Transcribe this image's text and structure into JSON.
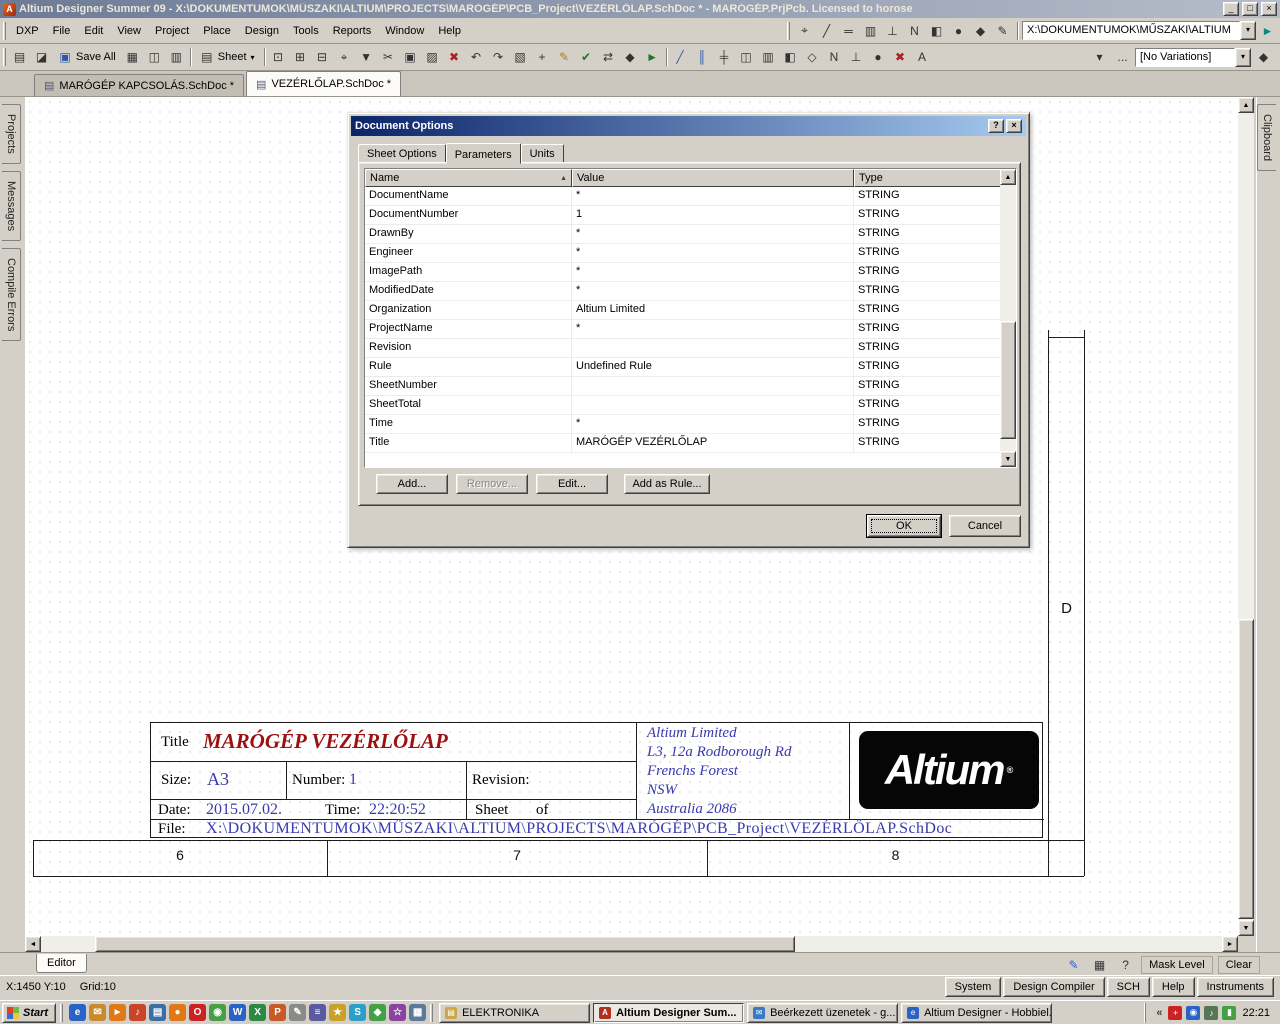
{
  "colors": {
    "window_face": "#d4d0c8",
    "dialog_title_left": "#0a246a",
    "dialog_title_right": "#a6caf0",
    "sheet_blue": "#3939b0",
    "sheet_title_red": "#9b1111"
  },
  "icons": {
    "minimize": "_",
    "maximize": "□",
    "close": "×",
    "help": "?",
    "dropdown": "▾",
    "sort_asc": "▲",
    "overflow": "...",
    "up": "▲",
    "down": "▼",
    "left": "◄",
    "right": "►",
    "chevron_left": "«"
  },
  "titlebar": {
    "title": "Altium Designer Summer 09 - X:\\DOKUMENTUMOK\\MŰSZAKI\\ALTIUM\\PROJECTS\\MARÓGÉP\\PCB_Project\\VEZÉRLŐLAP.SchDoc * - MARÓGÉP.PrjPcb. Licensed to horose"
  },
  "menubar": {
    "items": [
      "DXP",
      "File",
      "Edit",
      "View",
      "Project",
      "Place",
      "Design",
      "Tools",
      "Reports",
      "Window",
      "Help"
    ],
    "tool_icons": [
      {
        "name": "cross-select-icon",
        "glyph": "⌖"
      },
      {
        "name": "wire-icon",
        "glyph": "╱"
      },
      {
        "name": "bus-icon",
        "glyph": "═"
      },
      {
        "name": "part-icon",
        "glyph": "▥"
      },
      {
        "name": "power-port-icon",
        "glyph": "⊥"
      },
      {
        "name": "net-label-icon",
        "glyph": "N"
      },
      {
        "name": "port-icon",
        "glyph": "◧"
      },
      {
        "name": "junction-icon",
        "glyph": "●"
      },
      {
        "name": "directive-icon",
        "glyph": "◆"
      },
      {
        "name": "annotate-icon",
        "glyph": "✎"
      }
    ],
    "address_value": "X:\\DOKUMENTUMOK\\MŰSZAKI\\ALTIUM"
  },
  "toolbar": {
    "icons_a": [
      {
        "name": "new-document-icon",
        "glyph": "▤"
      },
      {
        "name": "open-icon",
        "glyph": "◪"
      }
    ],
    "save_all_label": "Save All",
    "icons_b": [
      {
        "name": "print-icon",
        "glyph": "▦"
      },
      {
        "name": "print-preview-icon",
        "glyph": "◫"
      },
      {
        "name": "device-view-icon",
        "glyph": "▥"
      }
    ],
    "sheet_label": "Sheet",
    "icons_c": [
      {
        "name": "zoom-fit-icon",
        "glyph": "⊡"
      },
      {
        "name": "zoom-area-icon",
        "glyph": "⊞"
      },
      {
        "name": "zoom-selected-icon",
        "glyph": "⊟"
      },
      {
        "name": "cross-probe-icon",
        "glyph": "⌖"
      },
      {
        "name": "filter-icon",
        "glyph": "▼"
      },
      {
        "name": "cut-icon",
        "glyph": "✂"
      },
      {
        "name": "copy-icon",
        "glyph": "▣"
      },
      {
        "name": "paste-icon",
        "glyph": "▨"
      },
      {
        "name": "clear-filter-icon",
        "glyph": "✖",
        "color": "#aa2222"
      },
      {
        "name": "undo-icon",
        "glyph": "↶"
      },
      {
        "name": "redo-icon",
        "glyph": "↷"
      },
      {
        "name": "select-area-icon",
        "glyph": "▧"
      },
      {
        "name": "move-selection-icon",
        "glyph": "+"
      },
      {
        "name": "highlight-pen-icon",
        "glyph": "✎",
        "color": "#b87818"
      },
      {
        "name": "compile-icon",
        "glyph": "✔",
        "color": "#227722"
      },
      {
        "name": "navigate-icon",
        "glyph": "⇄"
      },
      {
        "name": "browse-library-icon",
        "glyph": "◆"
      },
      {
        "name": "run-script-icon",
        "glyph": "►",
        "color": "#227722"
      }
    ],
    "icons_d": [
      {
        "name": "place-wire-icon",
        "glyph": "╱",
        "color": "#2a5aaa"
      },
      {
        "name": "place-bus-icon",
        "glyph": "║",
        "color": "#2a5aaa"
      },
      {
        "name": "place-signal-harness-icon",
        "glyph": "╪"
      },
      {
        "name": "place-part-icon",
        "glyph": "◫"
      },
      {
        "name": "place-sheet-symbol-icon",
        "glyph": "▥"
      },
      {
        "name": "place-sheet-entry-icon",
        "glyph": "◧"
      },
      {
        "name": "place-port-icon",
        "glyph": "◇"
      },
      {
        "name": "place-net-label-icon",
        "glyph": "N"
      },
      {
        "name": "place-power-port-icon",
        "glyph": "⊥"
      },
      {
        "name": "place-junction-icon",
        "glyph": "●"
      },
      {
        "name": "place-no-erc-icon",
        "glyph": "✖",
        "color": "#aa2222"
      },
      {
        "name": "place-text-icon",
        "glyph": "A"
      }
    ],
    "variations_value": "[No Variations]"
  },
  "tabs": {
    "documents": [
      {
        "name": "tab-marogep-kapcsolas",
        "label": "MARÓGÉP KAPCSOLÁS.SchDoc *",
        "glyph": "▤",
        "active": false
      },
      {
        "name": "tab-vezerlolap",
        "label": "VEZÉRLŐLAP.SchDoc *",
        "glyph": "▤",
        "active": true
      }
    ]
  },
  "panels": {
    "left": [
      {
        "name": "sidebar-tab-projects",
        "label": "Projects"
      },
      {
        "name": "sidebar-tab-messages",
        "label": "Messages"
      },
      {
        "name": "sidebar-tab-compile-errors",
        "label": "Compile Errors"
      }
    ],
    "right_label": "Clipboard"
  },
  "dialog": {
    "title": "Document Options",
    "tabs": [
      {
        "name": "tab-sheet-options",
        "label": "Sheet Options",
        "active": false
      },
      {
        "name": "tab-parameters",
        "label": "Parameters",
        "active": true
      },
      {
        "name": "tab-units",
        "label": "Units",
        "active": false
      }
    ],
    "table": {
      "columns": [
        "Name",
        "Value",
        "Type"
      ],
      "rows": [
        {
          "name": "DocumentName",
          "value": "*",
          "type": "STRING"
        },
        {
          "name": "DocumentNumber",
          "value": "1",
          "type": "STRING"
        },
        {
          "name": "DrawnBy",
          "value": "*",
          "type": "STRING"
        },
        {
          "name": "Engineer",
          "value": "*",
          "type": "STRING"
        },
        {
          "name": "ImagePath",
          "value": "*",
          "type": "STRING"
        },
        {
          "name": "ModifiedDate",
          "value": "*",
          "type": "STRING"
        },
        {
          "name": "Organization",
          "value": "Altium Limited",
          "type": "STRING"
        },
        {
          "name": "ProjectName",
          "value": "*",
          "type": "STRING"
        },
        {
          "name": "Revision",
          "value": "",
          "type": "STRING"
        },
        {
          "name": "Rule",
          "value": "Undefined Rule",
          "type": "STRING"
        },
        {
          "name": "SheetNumber",
          "value": "",
          "type": "STRING"
        },
        {
          "name": "SheetTotal",
          "value": "",
          "type": "STRING"
        },
        {
          "name": "Time",
          "value": "*",
          "type": "STRING"
        },
        {
          "name": "Title",
          "value": "MARÓGÉP VEZÉRLŐLAP",
          "type": "STRING"
        }
      ]
    },
    "buttons": {
      "add": "Add...",
      "remove": "Remove...",
      "edit": "Edit...",
      "add_as_rule": "Add as Rule...",
      "ok": "OK",
      "cancel": "Cancel"
    }
  },
  "sheet": {
    "title_label": "Title",
    "title": "MARÓGÉP VEZÉRLŐLAP",
    "size_label": "Size:",
    "size": "A3",
    "number_label": "Number:",
    "number": "1",
    "revision_label": "Revision:",
    "date_label": "Date:",
    "date": "2015.07.02.",
    "time_label": "Time:",
    "time": "22:20:52",
    "sheet_label": "Sheet",
    "of_label": "of",
    "file_label": "File:",
    "file": "X:\\DOKUMENTUMOK\\MŰSZAKI\\ALTIUM\\PROJECTS\\MARÓGÉP\\PCB_Project\\VEZÉRLŐLAP.SchDoc",
    "address_lines": [
      "Altium Limited",
      "L3, 12a Rodborough Rd",
      "Frenchs Forest",
      "NSW",
      "Australia 2086"
    ],
    "logo_text": "Altium",
    "logo_reg": "®",
    "grid_numbers": [
      "6",
      "7",
      "8"
    ],
    "row_letter": "D"
  },
  "statusbar": {
    "position": "X:1450 Y:10",
    "grid": "Grid:10",
    "panels": [
      {
        "name": "panel-button-system",
        "label": "System"
      },
      {
        "name": "panel-button-design-compiler",
        "label": "Design Compiler"
      },
      {
        "name": "panel-button-sch",
        "label": "SCH"
      },
      {
        "name": "panel-button-help",
        "label": "Help"
      },
      {
        "name": "panel-button-instruments",
        "label": "Instruments"
      }
    ]
  },
  "editor": {
    "tab_label": "Editor",
    "mask_level": "Mask Level",
    "clear": "Clear"
  },
  "taskbar": {
    "start_label": "Start",
    "quicklaunch": [
      {
        "name": "internet-explorer-quicklaunch-icon",
        "glyph": "e",
        "color": "#2a63c8"
      },
      {
        "name": "mail-quicklaunch-icon",
        "glyph": "✉",
        "color": "#c88a2a"
      },
      {
        "name": "media-player-quicklaunch-icon",
        "glyph": "►",
        "color": "#e07818"
      },
      {
        "name": "music-quicklaunch-icon",
        "glyph": "♪",
        "color": "#c8442a"
      },
      {
        "name": "file-manager-quicklaunch-icon",
        "glyph": "▤",
        "color": "#3a6ea5"
      },
      {
        "name": "firefox-quicklaunch-icon",
        "glyph": "●",
        "color": "#e07818"
      },
      {
        "name": "opera-quicklaunch-icon",
        "glyph": "O",
        "color": "#cc2222"
      },
      {
        "name": "chrome-quicklaunch-icon",
        "glyph": "◉",
        "color": "#44a044"
      },
      {
        "name": "word-quicklaunch-icon",
        "glyph": "W",
        "color": "#2a63c8"
      },
      {
        "name": "excel-quicklaunch-icon",
        "glyph": "X",
        "color": "#2a8a44"
      },
      {
        "name": "powerpoint-quicklaunch-icon",
        "glyph": "P",
        "color": "#c85a2a"
      },
      {
        "name": "notepad-quicklaunch-icon",
        "glyph": "✎",
        "color": "#8a8a8a"
      },
      {
        "name": "calculator-quicklaunch-icon",
        "glyph": "≡",
        "color": "#5a5aa0"
      },
      {
        "name": "paint-quicklaunch-icon",
        "glyph": "★",
        "color": "#c8a02a"
      },
      {
        "name": "skype-quicklaunch-icon",
        "glyph": "S",
        "color": "#2aa0c8"
      },
      {
        "name": "messenger-quicklaunch-icon",
        "glyph": "◆",
        "color": "#44a044"
      },
      {
        "name": "photos-quicklaunch-icon",
        "glyph": "☆",
        "color": "#8a44a0"
      },
      {
        "name": "desktop-quicklaunch-icon",
        "glyph": "▦",
        "color": "#5a7a9a"
      }
    ],
    "tasks": [
      {
        "name": "task-elektronika",
        "label": "ELEKTRONIKA",
        "glyph": "▤",
        "color": "#caa84a",
        "active": false
      },
      {
        "name": "task-altium-designer",
        "label": "Altium Designer Sum...",
        "glyph": "A",
        "color": "#b03020",
        "active": true
      },
      {
        "name": "task-inbox",
        "label": "Beérkezett üzenetek - g...",
        "glyph": "✉",
        "color": "#3a78c8",
        "active": false
      },
      {
        "name": "task-browser",
        "label": "Altium Designer - Hobbiel...",
        "glyph": "e",
        "color": "#2a63c8",
        "active": false
      }
    ],
    "tray_icons": [
      {
        "name": "antivirus-tray-icon",
        "glyph": "+",
        "color": "#cc2222"
      },
      {
        "name": "update-tray-icon",
        "glyph": "◉",
        "color": "#2a63c8"
      },
      {
        "name": "volume-tray-icon",
        "glyph": "♪",
        "color": "#557755"
      },
      {
        "name": "network-tray-icon",
        "glyph": "▮",
        "color": "#44a044"
      }
    ],
    "clock": "22:21"
  }
}
